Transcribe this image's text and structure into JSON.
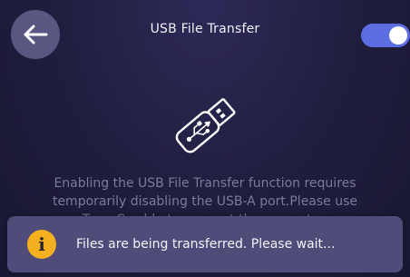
{
  "header": {
    "title": "USB File Transfer",
    "back_icon": "arrow-left-icon",
    "toggle": {
      "state": "on",
      "accent_color": "#5b6de0"
    }
  },
  "illustration": {
    "icon": "usb-drive-icon"
  },
  "main": {
    "description": "Enabling the USB File Transfer function requires temporarily disabling the USB-A port.Please use Type-C cable to connect the computer."
  },
  "toast": {
    "icon": "info-icon",
    "icon_glyph": "i",
    "icon_color": "#f4b01e",
    "message": "Files are being transferred. Please wait..."
  }
}
